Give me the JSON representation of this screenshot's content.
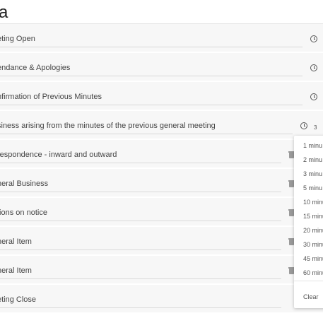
{
  "page": {
    "title": "a"
  },
  "agenda": {
    "items": [
      {
        "label": "eting Open"
      },
      {
        "label": "endance & Apologies"
      },
      {
        "label": "nfirmation of Previous Minutes"
      },
      {
        "label": "siness arising from the minutes of the previous general meeting",
        "duration_count": "3"
      },
      {
        "label": "respondence - inward and outward"
      },
      {
        "label": "neral Business"
      },
      {
        "label": "tions on notice"
      },
      {
        "label": "neral Item"
      },
      {
        "label": "neral Item"
      },
      {
        "label": "eting Close"
      }
    ]
  },
  "duration_menu": {
    "options": [
      "1 minu",
      "2 minu",
      "3 minu",
      "5 minu",
      "10 minu",
      "15 minu",
      "20 minu",
      "30 minu",
      "45 minu",
      "60 minu"
    ],
    "clear_label": "Clear"
  },
  "colors": {
    "row_background": "#f7f7f7",
    "icon": "#555555",
    "trash_icon": "#9a9a9a"
  }
}
